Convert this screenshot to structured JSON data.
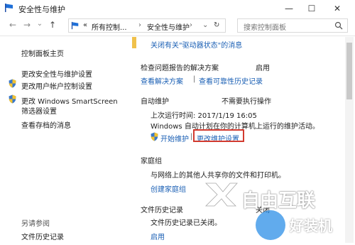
{
  "window": {
    "title": "安全性与维护",
    "controls": {
      "minimize": "—",
      "maximize": "☐",
      "close": "✕"
    }
  },
  "nav": {
    "back": "←",
    "forward": "→",
    "recent": "⌄",
    "up": "↑",
    "address_prefix": "«",
    "breadcrumb": [
      "所有控制...",
      "安全性与维护"
    ],
    "separator": "›",
    "address_dropdown": "⌄",
    "refresh": "↻",
    "search_placeholder": "搜索控制面板"
  },
  "sidebar": {
    "items": [
      {
        "label": "控制面板主页"
      },
      {
        "label": "更改安全性与维护设置"
      },
      {
        "label": "更改用户帐户控制设置",
        "shield": true
      },
      {
        "label": "更改 Windows SmartScreen",
        "shield": true
      },
      {
        "label": "筛选器设置"
      },
      {
        "label": "查看存档的消息"
      }
    ],
    "see_also_title": "另请参阅",
    "see_also_items": [
      {
        "label": "文件历史记录"
      }
    ]
  },
  "main": {
    "banner_link": "关闭有关\"驱动器状态\"的消息",
    "problem_reports": {
      "label": "检查问题报告的解决方案",
      "status": "启用",
      "link1": "查看解决方案",
      "sep": "|",
      "link2": "查看可靠性历史记录"
    },
    "maintenance": {
      "title": "自动维护",
      "status": "不需要执行操作",
      "last_run": "上次运行时间: 2017/1/19 16:05",
      "description": "Windows 自动计划在你的计算机上运行的维护活动。",
      "start_link": "开始维护",
      "sep": "|",
      "settings_link": "更改维护设置"
    },
    "homegroup": {
      "title": "家庭组",
      "status": "",
      "description": "与网络上的其他人共享你的文件和打印机。",
      "link": "创建家庭组"
    },
    "file_history": {
      "title": "文件历史记录",
      "status": "关闭",
      "description": "文件历史记录已关闭。",
      "link": "启用"
    }
  },
  "watermark": {
    "text1": "自由互联",
    "text2": "好装机"
  },
  "colors": {
    "link": "#1a5fb4",
    "highlight": "#d23a2f",
    "banner": "#f0c14b"
  }
}
